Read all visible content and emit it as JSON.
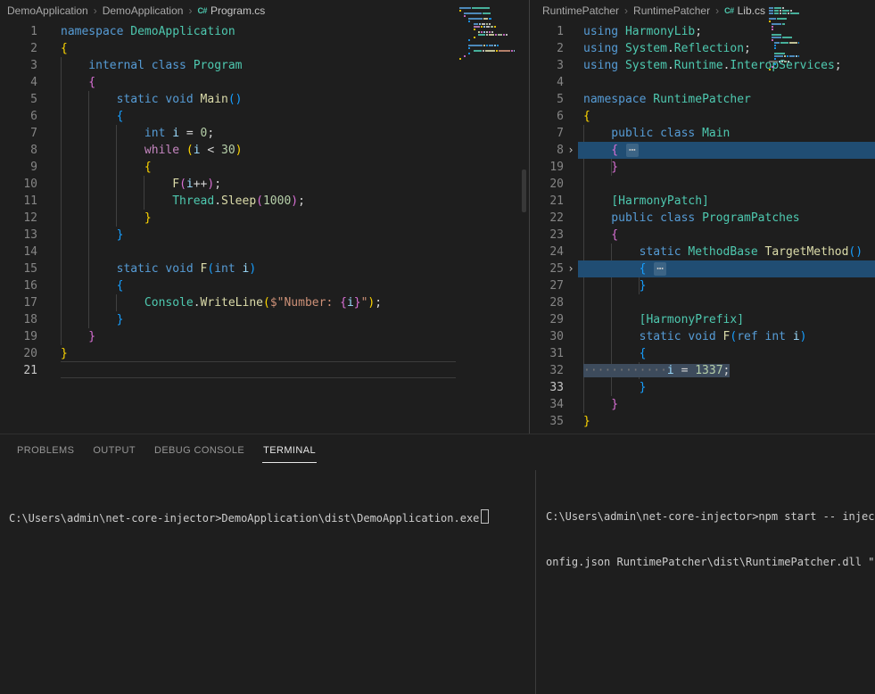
{
  "theme": {
    "background": "#1e1e1e",
    "kw": "#569cd6",
    "ctrl": "#c586c0",
    "type": "#4ec9b0",
    "method": "#dcdcaa",
    "var": "#9cdcfe",
    "num": "#b5cea8",
    "str": "#ce9178",
    "punct": "#d4d4d4",
    "b1": "#ffd700",
    "b2": "#da70d6",
    "b3": "#179fff",
    "ws": "#767676",
    "line_number": "#858585",
    "line_number_active": "#c6c6c6",
    "fold_row_bg": "#204d73",
    "selection_bg": "#3d4b5c",
    "breadcrumb_fg": "#a9a9a9",
    "tab_fg": "#969696",
    "tab_active_fg": "#e7e7e7",
    "terminal_fg": "#cccccc"
  },
  "icons": {
    "csharp_file": "C#",
    "chevron": "›",
    "fold_ellipsis": "⋯"
  },
  "left_editor": {
    "breadcrumb": {
      "items": [
        "DemoApplication",
        "DemoApplication",
        "Program.cs"
      ]
    },
    "lines": [
      {
        "n": 1,
        "segs": [
          [
            "namespace ",
            "kw"
          ],
          [
            "DemoApplication",
            "type"
          ]
        ]
      },
      {
        "n": 2,
        "segs": [
          [
            "{",
            "b1"
          ]
        ]
      },
      {
        "n": 3,
        "segs": [
          [
            "    internal class ",
            "kw"
          ],
          [
            "Program",
            "type"
          ]
        ]
      },
      {
        "n": 4,
        "segs": [
          [
            "    {",
            "b2"
          ]
        ]
      },
      {
        "n": 5,
        "segs": [
          [
            "        static void ",
            "kw"
          ],
          [
            "Main",
            "method"
          ],
          [
            "()",
            "b3"
          ]
        ]
      },
      {
        "n": 6,
        "segs": [
          [
            "        {",
            "b3"
          ]
        ]
      },
      {
        "n": 7,
        "segs": [
          [
            "            int ",
            "kw"
          ],
          [
            "i",
            "var"
          ],
          [
            " = ",
            "punct"
          ],
          [
            "0",
            "num"
          ],
          [
            ";",
            "punct"
          ]
        ]
      },
      {
        "n": 8,
        "segs": [
          [
            "            while ",
            "ctrl"
          ],
          [
            "(",
            "b1"
          ],
          [
            "i",
            "var"
          ],
          [
            " < ",
            "punct"
          ],
          [
            "30",
            "num"
          ],
          [
            ")",
            "b1"
          ]
        ]
      },
      {
        "n": 9,
        "segs": [
          [
            "            {",
            "b1"
          ]
        ]
      },
      {
        "n": 10,
        "segs": [
          [
            "                F",
            "method"
          ],
          [
            "(",
            "b2"
          ],
          [
            "i",
            "var"
          ],
          [
            "++",
            "punct"
          ],
          [
            ")",
            "b2"
          ],
          [
            ";",
            "punct"
          ]
        ]
      },
      {
        "n": 11,
        "segs": [
          [
            "                Thread",
            "type"
          ],
          [
            ".",
            "punct"
          ],
          [
            "Sleep",
            "method"
          ],
          [
            "(",
            "b2"
          ],
          [
            "1000",
            "num"
          ],
          [
            ")",
            "b2"
          ],
          [
            ";",
            "punct"
          ]
        ]
      },
      {
        "n": 12,
        "segs": [
          [
            "            }",
            "b1"
          ]
        ]
      },
      {
        "n": 13,
        "segs": [
          [
            "        }",
            "b3"
          ]
        ]
      },
      {
        "n": 14,
        "segs": []
      },
      {
        "n": 15,
        "segs": [
          [
            "        static void ",
            "kw"
          ],
          [
            "F",
            "method"
          ],
          [
            "(",
            "b3"
          ],
          [
            "int ",
            "kw"
          ],
          [
            "i",
            "var"
          ],
          [
            ")",
            "b3"
          ]
        ]
      },
      {
        "n": 16,
        "segs": [
          [
            "        {",
            "b3"
          ]
        ]
      },
      {
        "n": 17,
        "segs": [
          [
            "            Console",
            "type"
          ],
          [
            ".",
            "punct"
          ],
          [
            "WriteLine",
            "method"
          ],
          [
            "(",
            "b1"
          ],
          [
            "$\"Number: ",
            "str"
          ],
          [
            "{",
            "b2"
          ],
          [
            "i",
            "var"
          ],
          [
            "}",
            "b2"
          ],
          [
            "\"",
            "str"
          ],
          [
            ")",
            "b1"
          ],
          [
            ";",
            "punct"
          ]
        ]
      },
      {
        "n": 18,
        "segs": [
          [
            "        }",
            "b3"
          ]
        ]
      },
      {
        "n": 19,
        "segs": [
          [
            "    }",
            "b2"
          ]
        ]
      },
      {
        "n": 20,
        "segs": [
          [
            "}",
            "b1"
          ]
        ]
      },
      {
        "n": 21,
        "segs": [],
        "active": true
      }
    ]
  },
  "right_editor": {
    "breadcrumb": {
      "items": [
        "RuntimePatcher",
        "RuntimePatcher",
        "Lib.cs"
      ]
    },
    "lines": [
      {
        "n": 1,
        "segs": [
          [
            "using ",
            "kw"
          ],
          [
            "HarmonyLib",
            "type"
          ],
          [
            ";",
            "punct"
          ]
        ]
      },
      {
        "n": 2,
        "segs": [
          [
            "using ",
            "kw"
          ],
          [
            "System",
            "type"
          ],
          [
            ".",
            "punct"
          ],
          [
            "Reflection",
            "type"
          ],
          [
            ";",
            "punct"
          ]
        ]
      },
      {
        "n": 3,
        "segs": [
          [
            "using ",
            "kw"
          ],
          [
            "System",
            "type"
          ],
          [
            ".",
            "punct"
          ],
          [
            "Runtime",
            "type"
          ],
          [
            ".",
            "punct"
          ],
          [
            "InteropServices",
            "type"
          ],
          [
            ";",
            "punct"
          ]
        ]
      },
      {
        "n": 4,
        "segs": []
      },
      {
        "n": 5,
        "segs": [
          [
            "namespace ",
            "kw"
          ],
          [
            "RuntimePatcher",
            "type"
          ]
        ]
      },
      {
        "n": 6,
        "segs": [
          [
            "{",
            "b1"
          ]
        ]
      },
      {
        "n": 7,
        "segs": [
          [
            "    public class ",
            "kw"
          ],
          [
            "Main",
            "type"
          ]
        ]
      },
      {
        "n": 8,
        "segs": [
          [
            "    { ",
            "b2"
          ]
        ],
        "fold": true
      },
      {
        "n": 19,
        "segs": [
          [
            "    }",
            "b2"
          ]
        ]
      },
      {
        "n": 20,
        "segs": []
      },
      {
        "n": 21,
        "segs": [
          [
            "    ",
            "punct"
          ],
          [
            "[HarmonyPatch]",
            "type"
          ]
        ]
      },
      {
        "n": 22,
        "segs": [
          [
            "    public class ",
            "kw"
          ],
          [
            "ProgramPatches",
            "type"
          ]
        ]
      },
      {
        "n": 23,
        "segs": [
          [
            "    {",
            "b2"
          ]
        ]
      },
      {
        "n": 24,
        "segs": [
          [
            "        static ",
            "kw"
          ],
          [
            "MethodBase ",
            "type"
          ],
          [
            "TargetMethod",
            "method"
          ],
          [
            "()",
            "b3"
          ]
        ]
      },
      {
        "n": 25,
        "segs": [
          [
            "        { ",
            "b3"
          ]
        ],
        "fold": true
      },
      {
        "n": 27,
        "segs": [
          [
            "        }",
            "b3"
          ]
        ]
      },
      {
        "n": 28,
        "segs": []
      },
      {
        "n": 29,
        "segs": [
          [
            "        ",
            "punct"
          ],
          [
            "[HarmonyPrefix]",
            "type"
          ]
        ]
      },
      {
        "n": 30,
        "segs": [
          [
            "        static void ",
            "kw"
          ],
          [
            "F",
            "method"
          ],
          [
            "(",
            "b3"
          ],
          [
            "ref int ",
            "kw"
          ],
          [
            "i",
            "var"
          ],
          [
            ")",
            "b3"
          ]
        ]
      },
      {
        "n": 31,
        "segs": [
          [
            "        {",
            "b3"
          ]
        ]
      },
      {
        "n": 32,
        "segs": [
          [
            "············",
            "ws"
          ],
          [
            "i",
            "var"
          ],
          [
            " = ",
            "punct"
          ],
          [
            "1337",
            "num"
          ],
          [
            ";",
            "punct"
          ]
        ],
        "sel": true
      },
      {
        "n": 33,
        "segs": [
          [
            "        }",
            "b3"
          ]
        ],
        "active": true
      },
      {
        "n": 34,
        "segs": [
          [
            "    }",
            "b2"
          ]
        ]
      },
      {
        "n": 35,
        "segs": [
          [
            "}",
            "b1"
          ]
        ]
      }
    ]
  },
  "panel": {
    "tabs": [
      {
        "label": "PROBLEMS"
      },
      {
        "label": "OUTPUT"
      },
      {
        "label": "DEBUG CONSOLE"
      },
      {
        "label": "TERMINAL"
      }
    ],
    "active_tab": "TERMINAL",
    "terminal_left": {
      "lines": [
        "C:\\Users\\admin\\net-core-injector>DemoApplication\\dist\\DemoApplication.exe"
      ]
    },
    "terminal_right": {
      "lines": [
        "C:\\Users\\admin\\net-core-injector>npm start -- inject c",
        "onfig.json RuntimePatcher\\dist\\RuntimePatcher.dll \"Ru"
      ]
    }
  }
}
